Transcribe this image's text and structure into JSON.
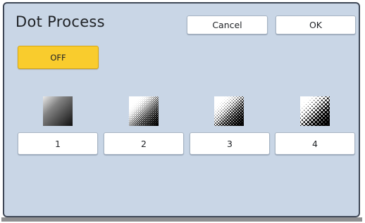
{
  "dialog": {
    "title": "Dot Process",
    "cancel_label": "Cancel",
    "ok_label": "OK"
  },
  "off_toggle": {
    "label": "OFF",
    "selected": true
  },
  "dot_options": [
    {
      "label": "1",
      "icon": "fine-halftone-swatch-icon"
    },
    {
      "label": "2",
      "icon": "medium-fine-halftone-swatch-icon"
    },
    {
      "label": "3",
      "icon": "medium-coarse-halftone-swatch-icon"
    },
    {
      "label": "4",
      "icon": "coarse-halftone-swatch-icon"
    }
  ],
  "colors": {
    "panel_background": "#c9d6e6",
    "panel_border": "#3e4756",
    "button_background": "#ffffff",
    "off_button_active": "#f9cc2d",
    "text": "#1f2226"
  }
}
